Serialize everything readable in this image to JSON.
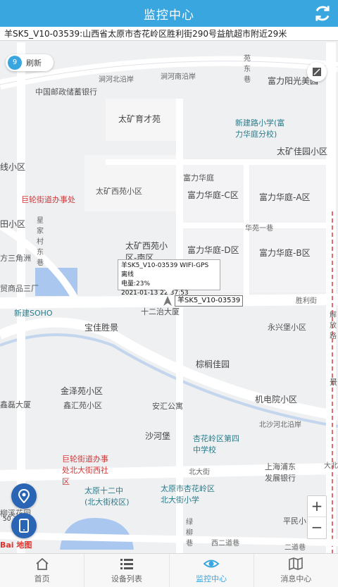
{
  "header": {
    "title": "监控中心"
  },
  "address": "羊SK5_V10-03539:山西省太原市杏花岭区胜利街290号益航超市附近29米",
  "map": {
    "refresh_count": "9",
    "refresh_label": "刷新",
    "popup": {
      "line1": "羊SK5_V10-03539 WIFI-GPS 离线",
      "line2": "电量:23%",
      "line3": "2021-01-13 22:37:53"
    },
    "device_label": "羊SK5_V10-03539",
    "zoom_in": "+",
    "zoom_out": "−",
    "logo": "Bai 地图",
    "scale": "50",
    "labels": [
      {
        "text": "涧河北沿岸",
        "cls": "road"
      },
      {
        "text": "涧河南沿岸",
        "cls": "road"
      },
      {
        "text": "中国邮政储蓄银行",
        "cls": ""
      },
      {
        "text": "富力阳光美园",
        "cls": "big"
      },
      {
        "text": "太矿育才苑",
        "cls": "big"
      },
      {
        "text": "新建路小学(富力华庭分校)",
        "cls": "teal"
      },
      {
        "text": "太矿佳园小区",
        "cls": "big"
      },
      {
        "text": "线小区",
        "cls": "big"
      },
      {
        "text": "富力华庭",
        "cls": ""
      },
      {
        "text": "巨轮街道办事处",
        "cls": "red"
      },
      {
        "text": "太矿西苑小区",
        "cls": ""
      },
      {
        "text": "富力华庭-C区",
        "cls": "big"
      },
      {
        "text": "富力华庭-A区",
        "cls": "big"
      },
      {
        "text": "田小区",
        "cls": "big"
      },
      {
        "text": "华苑一巷",
        "cls": "road"
      },
      {
        "text": "太矿西苑小区-南区",
        "cls": "big"
      },
      {
        "text": "富力华庭-D区",
        "cls": "big"
      },
      {
        "text": "富力华庭-B区",
        "cls": "big"
      },
      {
        "text": "方三角洲",
        "cls": ""
      },
      {
        "text": "贸商品三厂",
        "cls": ""
      },
      {
        "text": "胜利街",
        "cls": "road"
      },
      {
        "text": "新建SOHO",
        "cls": "teal"
      },
      {
        "text": "十二治大厦",
        "cls": ""
      },
      {
        "text": "宝佳胜景",
        "cls": "big"
      },
      {
        "text": "永兴堡小区",
        "cls": ""
      },
      {
        "text": "棕榈佳园",
        "cls": "big"
      },
      {
        "text": "金泽苑小区",
        "cls": "big"
      },
      {
        "text": "机电院小区",
        "cls": "big"
      },
      {
        "text": "鑫磊大厦",
        "cls": ""
      },
      {
        "text": "鑫汇苑小区",
        "cls": ""
      },
      {
        "text": "安汇公寓",
        "cls": ""
      },
      {
        "text": "沙河堡",
        "cls": "big"
      },
      {
        "text": "杏花岭区第四中学校",
        "cls": "teal"
      },
      {
        "text": "北沙河北沿岸",
        "cls": "road"
      },
      {
        "text": "巨轮街道办事处北大街西社区",
        "cls": "red"
      },
      {
        "text": "北大街",
        "cls": "road"
      },
      {
        "text": "上海浦东发展银行",
        "cls": ""
      },
      {
        "text": "太原十二中(北大街校区)",
        "cls": "teal"
      },
      {
        "text": "太原市杏花岭区北大街小学",
        "cls": "teal"
      },
      {
        "text": "平民小区",
        "cls": ""
      },
      {
        "text": "二道巷",
        "cls": "road"
      },
      {
        "text": "西二道巷",
        "cls": "road"
      },
      {
        "text": "柳溪花园",
        "cls": ""
      },
      {
        "text": "绿柳巷",
        "cls": "road"
      },
      {
        "text": "星家村东巷",
        "cls": "road"
      },
      {
        "text": "大北",
        "cls": "road"
      },
      {
        "text": "解放路",
        "cls": "road"
      },
      {
        "text": "苑东巷",
        "cls": "road"
      },
      {
        "text": "景",
        "cls": ""
      }
    ]
  },
  "tabs": [
    {
      "label": "首页"
    },
    {
      "label": "设备列表"
    },
    {
      "label": "监控中心"
    },
    {
      "label": "消息中心"
    }
  ],
  "colors": {
    "accent": "#3aa6df",
    "fab": "#2a64b4"
  }
}
